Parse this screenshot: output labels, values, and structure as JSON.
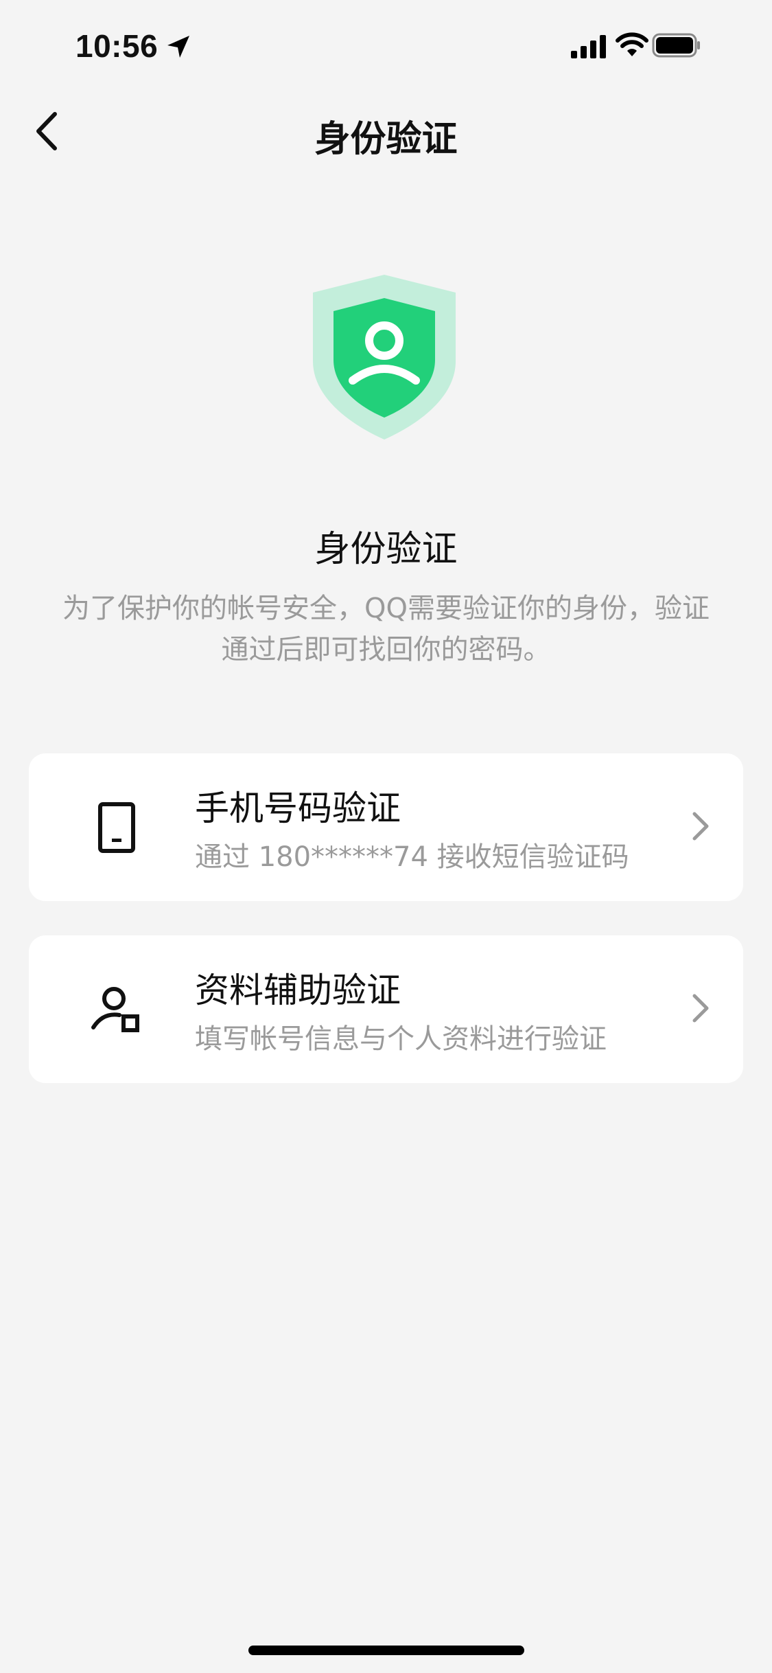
{
  "status_bar": {
    "time": "10:56",
    "icons": [
      "location-arrow-icon",
      "cellular-signal-icon",
      "wifi-icon",
      "battery-icon"
    ]
  },
  "nav": {
    "title": "身份验证",
    "back_icon": "chevron-left-icon"
  },
  "hero": {
    "icon": "shield-user-icon",
    "title": "身份验证",
    "description_line1": "为了保护你的帐号安全，QQ需要验证你的身份，验证",
    "description_line2": "通过后即可找回你的密码。"
  },
  "options": [
    {
      "icon": "phone-icon",
      "title": "手机号码验证",
      "subtitle": "通过 180******74 接收短信验证码"
    },
    {
      "icon": "user-id-icon",
      "title": "资料辅助验证",
      "subtitle": "填写帐号信息与个人资料进行验证"
    }
  ],
  "colors": {
    "background": "#f4f4f4",
    "card": "#ffffff",
    "shield_outer": "#c3eedb",
    "shield_inner": "#22d07a",
    "secondary_text": "#9a9a9a",
    "chevron": "#9a9a9a"
  }
}
